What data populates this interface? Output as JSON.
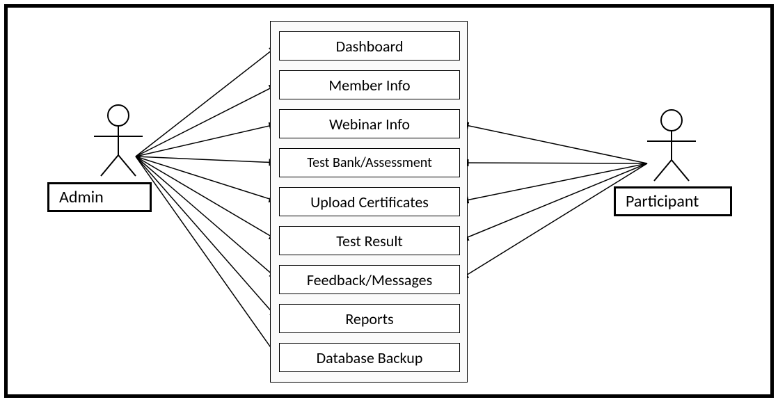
{
  "actors": {
    "admin": {
      "label": "Admin"
    },
    "participant": {
      "label": "Participant"
    }
  },
  "usecases": [
    {
      "label": "Dashboard"
    },
    {
      "label": "Member Info"
    },
    {
      "label": "Webinar Info"
    },
    {
      "label": "Test Bank/Assessment"
    },
    {
      "label": "Upload Certificates"
    },
    {
      "label": "Test Result"
    },
    {
      "label": "Feedback/Messages"
    },
    {
      "label": "Reports"
    },
    {
      "label": "Database Backup"
    }
  ],
  "layout_note": "UML-style use case diagram: Admin connects to all use cases; Participant connects to Webinar Info, Test Bank/Assessment, Upload Certificates, Test Result, Feedback/Messages."
}
